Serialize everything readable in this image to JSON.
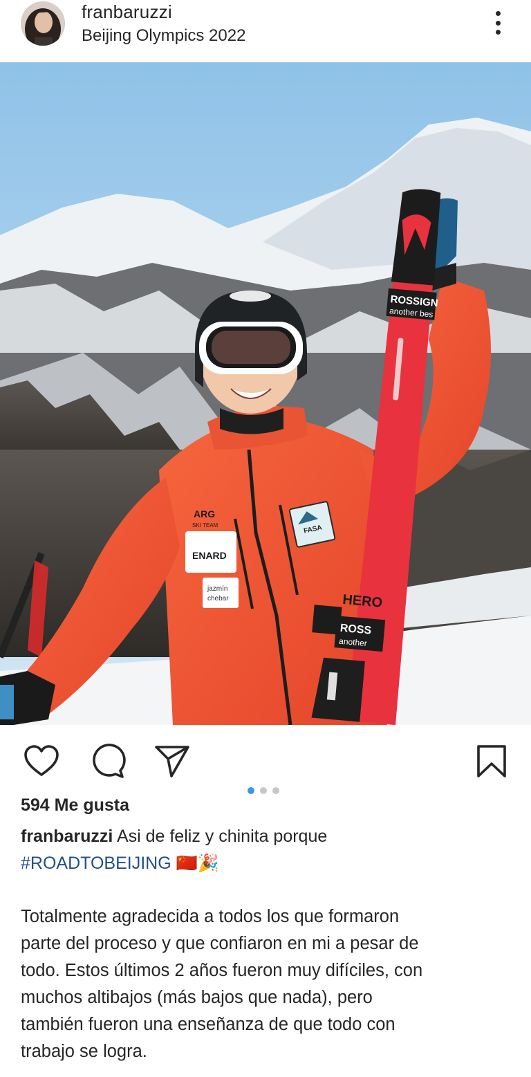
{
  "post": {
    "username": "franbaruzzi",
    "location": "Beijing Olympics 2022",
    "photo": {
      "jacket_team_label": "ARG",
      "jacket_team_sub": "SKI TEAM",
      "sponsor_patch": "ENARD",
      "brand_patch_line1": "jazmín",
      "brand_patch_line2": "chebar",
      "federation_patch": "FASA",
      "ski_brand_top": "ROSSIGN",
      "ski_tagline_top": "another bes",
      "ski_model": "HERO",
      "ski_brand_bottom": "ROSS",
      "ski_tagline_bottom": "another"
    },
    "carousel": {
      "count": 3,
      "active_index": 0
    },
    "likes": "594 Me gusta",
    "caption": {
      "author": "franbaruzzi",
      "line1": "Asi de feliz y chinita porque",
      "hashtag": "#ROADTOBEIJING",
      "emojis": "🇨🇳🎉",
      "body_lines": [
        "Totalmente agradecida a todos los que formaron",
        "parte del proceso y que confiaron en mi a pesar de",
        "todo. Estos últimos 2 años fueron muy difíciles, con",
        "muchos altibajos (más bajos que nada), pero",
        "también fueron una enseñanza de que todo con",
        "trabajo se logra."
      ]
    },
    "icons": {
      "like": "heart-icon",
      "comment": "comment-icon",
      "share": "paper-plane-icon",
      "save": "bookmark-icon",
      "more": "more-vertical-icon"
    },
    "colors": {
      "jacket": "#f0502e",
      "ski": "#e8323e",
      "sky": "#aed3ee",
      "hashtag": "#1f4e8c",
      "active_dot": "#3897f0"
    }
  }
}
